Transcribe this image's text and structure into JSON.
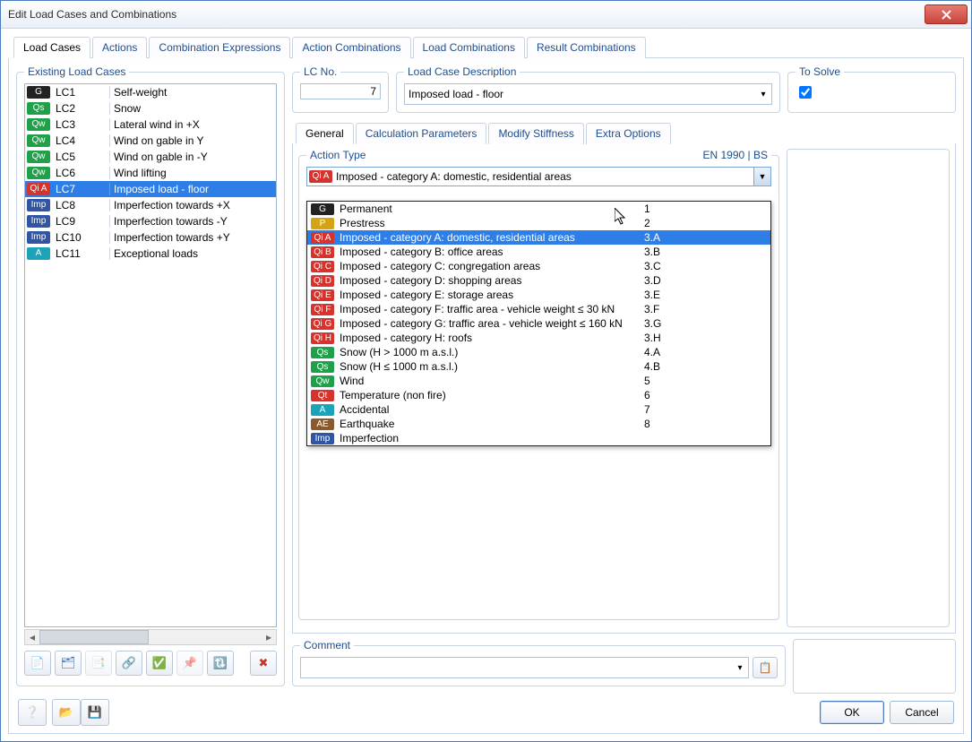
{
  "title": "Edit Load Cases and Combinations",
  "tabs": [
    "Load Cases",
    "Actions",
    "Combination Expressions",
    "Action Combinations",
    "Load Combinations",
    "Result Combinations"
  ],
  "activeTab": 0,
  "left": {
    "legend": "Existing Load Cases",
    "items": [
      {
        "tag": "G",
        "color": "bg-black",
        "code": "LC1",
        "desc": "Self-weight"
      },
      {
        "tag": "Qs",
        "color": "bg-green",
        "code": "LC2",
        "desc": "Snow"
      },
      {
        "tag": "Qw",
        "color": "bg-green",
        "code": "LC3",
        "desc": "Lateral wind in +X"
      },
      {
        "tag": "Qw",
        "color": "bg-green",
        "code": "LC4",
        "desc": "Wind on gable in Y"
      },
      {
        "tag": "Qw",
        "color": "bg-green",
        "code": "LC5",
        "desc": "Wind on gable in -Y"
      },
      {
        "tag": "Qw",
        "color": "bg-green",
        "code": "LC6",
        "desc": "Wind lifting"
      },
      {
        "tag": "Qi A",
        "color": "bg-red",
        "code": "LC7",
        "desc": "Imposed load - floor",
        "selected": true
      },
      {
        "tag": "Imp",
        "color": "bg-blue",
        "code": "LC8",
        "desc": "Imperfection towards +X"
      },
      {
        "tag": "Imp",
        "color": "bg-blue",
        "code": "LC9",
        "desc": "Imperfection towards -Y"
      },
      {
        "tag": "Imp",
        "color": "bg-blue",
        "code": "LC10",
        "desc": "Imperfection towards +Y"
      },
      {
        "tag": "A",
        "color": "bg-cyan",
        "code": "LC11",
        "desc": "Exceptional loads"
      }
    ]
  },
  "lcno_label": "LC No.",
  "lcno_value": "7",
  "desc_label": "Load Case Description",
  "desc_value": "Imposed load - floor",
  "solve_label": "To Solve",
  "solve_checked": true,
  "subtabs": [
    "General",
    "Calculation Parameters",
    "Modify Stiffness",
    "Extra Options"
  ],
  "activeSubTab": 0,
  "action_type_label": "Action Type",
  "standard_label": "EN 1990 | BS",
  "action_type_value_tag": "Qi A",
  "action_type_value_color": "bg-red",
  "action_type_value": "Imposed - category A: domestic, residential areas",
  "dropdown": [
    {
      "tag": "G",
      "color": "bg-black",
      "label": "Permanent",
      "num": "1"
    },
    {
      "tag": "P",
      "color": "bg-yellow",
      "label": "Prestress",
      "num": "2"
    },
    {
      "tag": "Qi A",
      "color": "bg-red",
      "label": "Imposed - category A: domestic, residential areas",
      "num": "3.A",
      "selected": true
    },
    {
      "tag": "Qi B",
      "color": "bg-red",
      "label": "Imposed - category B: office areas",
      "num": "3.B"
    },
    {
      "tag": "Qi C",
      "color": "bg-red",
      "label": "Imposed - category C: congregation areas",
      "num": "3.C"
    },
    {
      "tag": "Qi D",
      "color": "bg-red",
      "label": "Imposed - category D: shopping areas",
      "num": "3.D"
    },
    {
      "tag": "Qi E",
      "color": "bg-red",
      "label": "Imposed - category E: storage areas",
      "num": "3.E"
    },
    {
      "tag": "Qi F",
      "color": "bg-red",
      "label": "Imposed - category F: traffic area - vehicle weight ≤ 30 kN",
      "num": "3.F"
    },
    {
      "tag": "Qi G",
      "color": "bg-red",
      "label": "Imposed - category G: traffic area - vehicle weight ≤ 160 kN",
      "num": "3.G"
    },
    {
      "tag": "Qi H",
      "color": "bg-red",
      "label": "Imposed - category H: roofs",
      "num": "3.H"
    },
    {
      "tag": "Qs",
      "color": "bg-green",
      "label": "Snow (H > 1000 m a.s.l.)",
      "num": "4.A"
    },
    {
      "tag": "Qs",
      "color": "bg-green",
      "label": "Snow (H ≤ 1000 m a.s.l.)",
      "num": "4.B"
    },
    {
      "tag": "Qw",
      "color": "bg-green",
      "label": "Wind",
      "num": "5"
    },
    {
      "tag": "Qt",
      "color": "bg-red",
      "label": "Temperature (non fire)",
      "num": "6"
    },
    {
      "tag": "A",
      "color": "bg-cyan",
      "label": "Accidental",
      "num": "7"
    },
    {
      "tag": "AE",
      "color": "bg-brown",
      "label": "Earthquake",
      "num": "8"
    },
    {
      "tag": "Imp",
      "color": "bg-blue",
      "label": "Imperfection",
      "num": ""
    }
  ],
  "comment_label": "Comment",
  "buttons": {
    "ok": "OK",
    "cancel": "Cancel"
  }
}
